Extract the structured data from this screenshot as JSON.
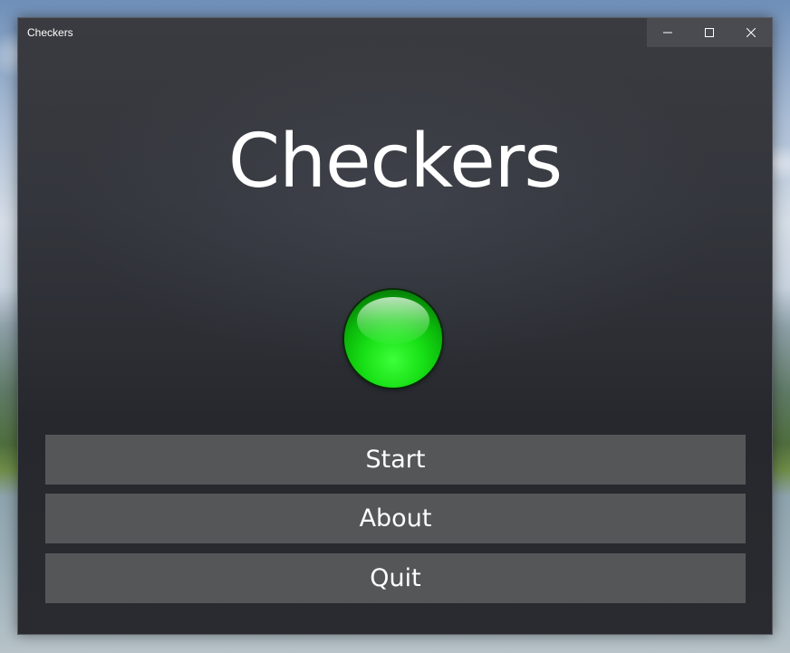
{
  "window": {
    "title": "Checkers",
    "controls": {
      "minimize_icon": "minimize-icon",
      "maximize_icon": "maximize-icon",
      "close_icon": "close-icon"
    }
  },
  "main": {
    "heading": "Checkers",
    "piece": {
      "icon": "green-checker-piece",
      "color": "#18e016"
    },
    "menu": [
      {
        "label": "Start"
      },
      {
        "label": "About"
      },
      {
        "label": "Quit"
      }
    ]
  },
  "colors": {
    "window_background": "#2b2d33",
    "button_background": "#555658",
    "text": "#ffffff"
  }
}
